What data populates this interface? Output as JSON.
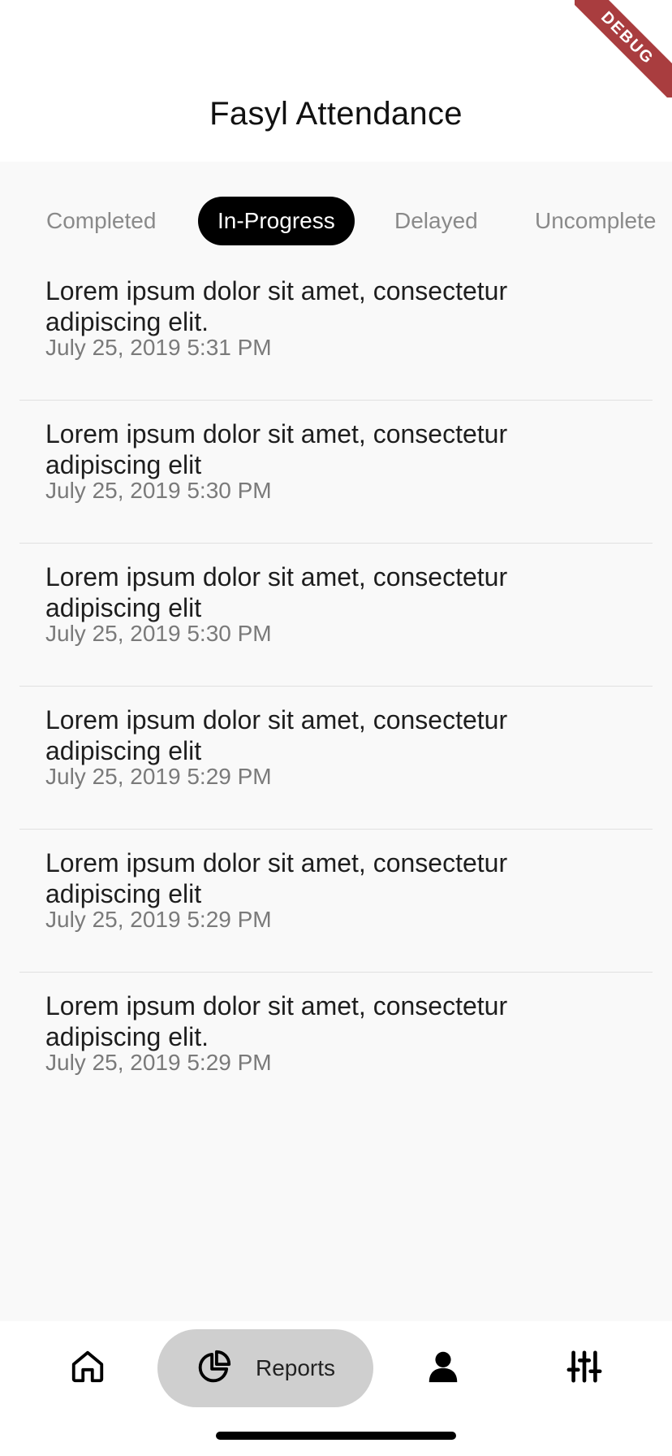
{
  "app": {
    "title": "Fasyl Attendance",
    "debug_banner": "DEBUG"
  },
  "tabs": [
    {
      "label": "Completed",
      "active": false
    },
    {
      "label": "In-Progress",
      "active": true
    },
    {
      "label": "Delayed",
      "active": false
    },
    {
      "label": "Uncomplete",
      "active": false
    }
  ],
  "items": [
    {
      "title": "Lorem ipsum dolor sit amet, consectetur adipiscing elit.",
      "time": "July 25, 2019 5:31 PM"
    },
    {
      "title": "Lorem ipsum dolor sit amet, consectetur adipiscing elit",
      "time": "July 25, 2019 5:30 PM"
    },
    {
      "title": "Lorem ipsum dolor sit amet, consectetur adipiscing elit",
      "time": "July 25, 2019 5:30 PM"
    },
    {
      "title": "Lorem ipsum dolor sit amet, consectetur adipiscing elit",
      "time": "July 25, 2019 5:29 PM"
    },
    {
      "title": "Lorem ipsum dolor sit amet, consectetur adipiscing elit",
      "time": "July 25, 2019 5:29 PM"
    },
    {
      "title": "Lorem ipsum dolor sit amet, consectetur adipiscing elit.",
      "time": "July 25, 2019 5:29 PM"
    }
  ],
  "bottom_nav": {
    "items": [
      {
        "icon": "home-icon"
      },
      {
        "icon": "pie-chart-icon",
        "label": "Reports",
        "active": true
      },
      {
        "icon": "person-icon"
      },
      {
        "icon": "sliders-icon"
      }
    ]
  },
  "colors": {
    "active_tab_bg": "#000000",
    "active_nav_bg": "#cfcfcf",
    "debug_banner": "#a93d3f"
  }
}
